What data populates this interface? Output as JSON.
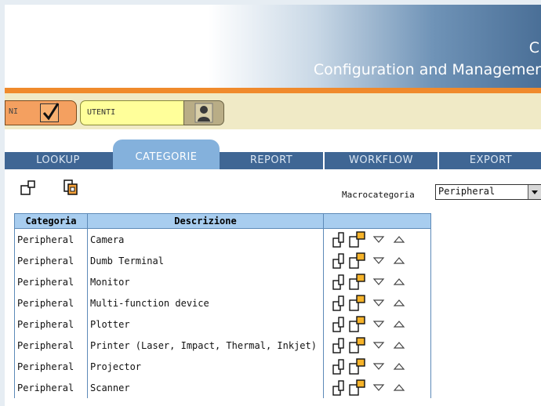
{
  "header": {
    "title_partial": "C",
    "subtitle_partial": "Configuration and Managemer"
  },
  "toolbar": {
    "modules_label_partial": "NI",
    "users_label": "UTENTI"
  },
  "tabs": [
    {
      "label": "LOOKUP",
      "active": false
    },
    {
      "label": "CATEGORIE",
      "active": true
    },
    {
      "label": "REPORT",
      "active": false
    },
    {
      "label": "WORKFLOW",
      "active": false
    },
    {
      "label": "EXPORT",
      "active": false
    }
  ],
  "filter": {
    "label": "Macrocategoria",
    "selected": "Peripheral"
  },
  "table": {
    "headers": [
      "Categoria",
      "Descrizione",
      ""
    ],
    "rows": [
      {
        "categoria": "Peripheral",
        "descrizione": "Camera"
      },
      {
        "categoria": "Peripheral",
        "descrizione": "Dumb Terminal"
      },
      {
        "categoria": "Peripheral",
        "descrizione": "Monitor"
      },
      {
        "categoria": "Peripheral",
        "descrizione": "Multi-function device"
      },
      {
        "categoria": "Peripheral",
        "descrizione": "Plotter"
      },
      {
        "categoria": "Peripheral",
        "descrizione": "Printer (Laser, Impact, Thermal, Inkjet)"
      },
      {
        "categoria": "Peripheral",
        "descrizione": "Projector"
      },
      {
        "categoria": "Peripheral",
        "descrizione": "Scanner"
      }
    ]
  },
  "colors": {
    "tab_bar": "#3f6694",
    "tab_active": "#84b1dc",
    "accent_orange": "#f08a2c",
    "toolbar_bg": "#f0eac6",
    "table_header": "#a8cdef"
  },
  "icons": [
    "checkbox-icon",
    "person-icon",
    "new-item-icon",
    "copy-item-icon",
    "edit-icon",
    "duplicate-icon",
    "move-down-icon",
    "move-up-icon",
    "dropdown-arrow-icon"
  ]
}
